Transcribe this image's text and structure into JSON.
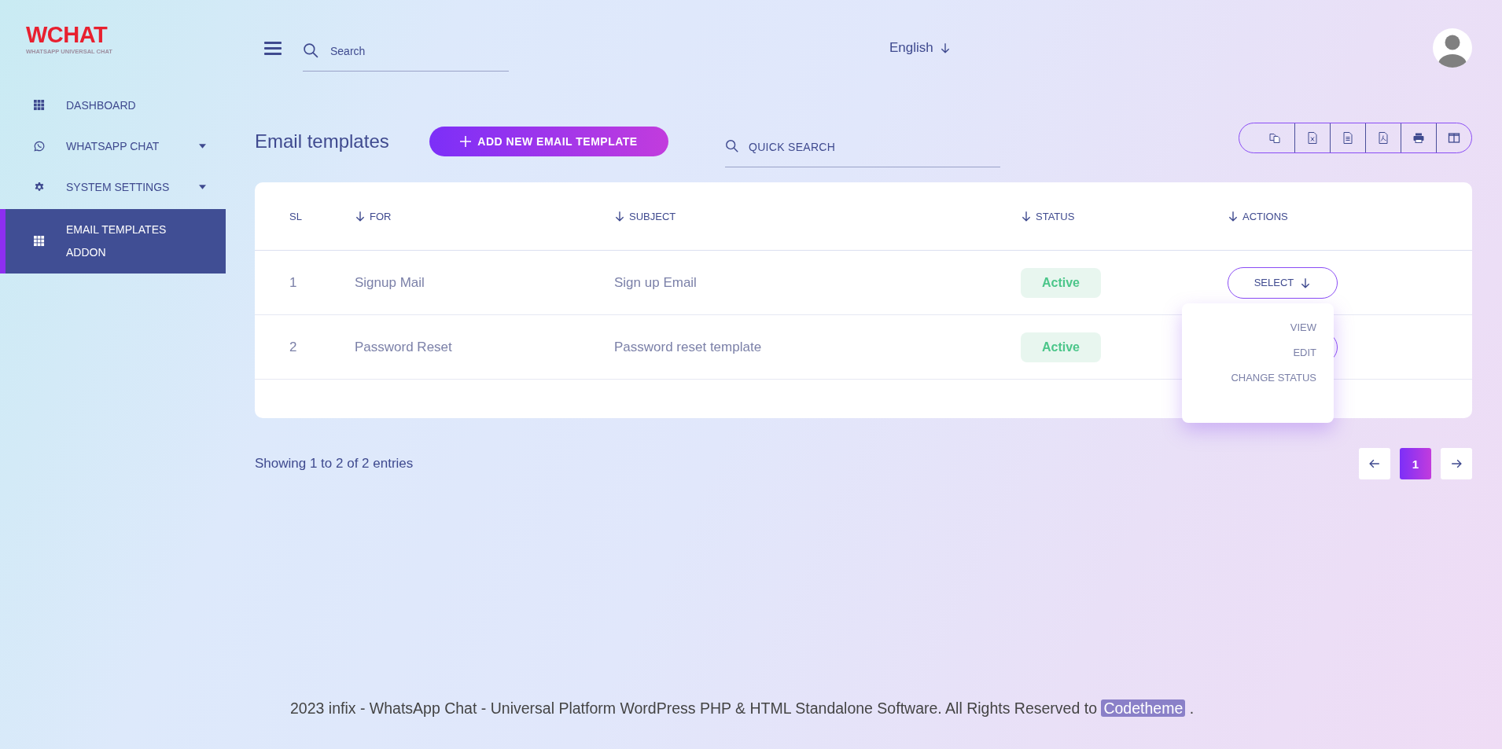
{
  "logo": {
    "title": "WCHAT",
    "subtitle": "WHATSAPP UNIVERSAL CHAT"
  },
  "sidebar": {
    "items": [
      {
        "label": "DASHBOARD",
        "kind": "grid",
        "has_caret": false,
        "selected": false
      },
      {
        "label": "WHATSAPP CHAT",
        "kind": "whatsapp",
        "has_caret": true,
        "selected": false
      },
      {
        "label": "SYSTEM SETTINGS",
        "kind": "gear",
        "has_caret": true,
        "selected": false
      },
      {
        "label": "EMAIL TEMPLATES ADDON",
        "kind": "grid",
        "has_caret": false,
        "selected": true
      }
    ]
  },
  "topbar": {
    "search": {
      "placeholder": "Search"
    },
    "language": "English"
  },
  "page": {
    "title": "Email templates",
    "add_button": "ADD NEW EMAIL TEMPLATE",
    "quick_search": {
      "placeholder": "QUICK SEARCH"
    }
  },
  "table": {
    "columns": [
      "SL",
      "FOR",
      "SUBJECT",
      "STATUS",
      "ACTIONS"
    ],
    "rows": [
      {
        "sl": "1",
        "for": "Signup Mail",
        "subject": "Sign up Email",
        "status": "Active",
        "action": "SELECT"
      },
      {
        "sl": "2",
        "for": "Password Reset",
        "subject": "Password reset template",
        "status": "Active"
      }
    ]
  },
  "dropdown": {
    "items": [
      "VIEW",
      "EDIT",
      "CHANGE STATUS"
    ]
  },
  "pagination": {
    "info": "Showing 1 to 2 of 2 entries",
    "pages": [
      {
        "label": "1",
        "selected": true
      }
    ]
  },
  "footer": {
    "text": "2023 infix - WhatsApp Chat - Universal Platform WordPress PHP & HTML Standalone Software. All Rights Reserved to",
    "link": "Codetheme",
    "end": "."
  }
}
